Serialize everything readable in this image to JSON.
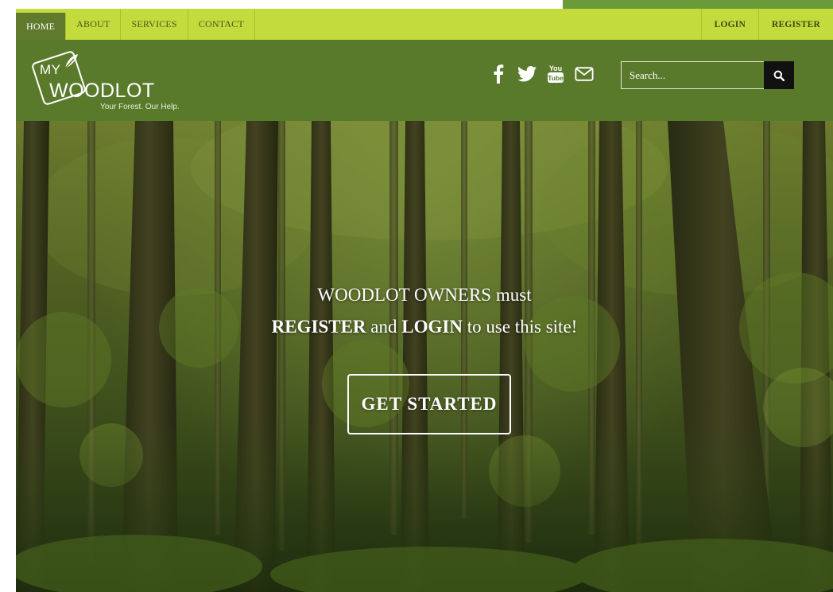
{
  "topnav": {
    "left_items": [
      {
        "label": "HOME",
        "active": true
      },
      {
        "label": "ABOUT"
      },
      {
        "label": "SERVICES"
      },
      {
        "label": "CONTACT"
      }
    ],
    "right_items": [
      {
        "label": "LOGIN"
      },
      {
        "label": "REGISTER"
      }
    ]
  },
  "logo": {
    "my": "MY",
    "name": "WOODLOT",
    "tagline": "Your Forest. Our Help."
  },
  "social": {
    "icons": [
      "facebook-icon",
      "twitter-icon",
      "youtube-icon",
      "email-icon"
    ]
  },
  "search": {
    "placeholder": "Search...",
    "icon": "search-icon"
  },
  "hero": {
    "line1": "WOODLOT OWNERS must",
    "line2_bold1": "REGISTER",
    "line2_mid": " and ",
    "line2_bold2": "LOGIN",
    "line2_end": " to use this site!",
    "cta_label": "GET STARTED"
  },
  "colors": {
    "topnav_bg": "#c3db3d",
    "header_bg": "#5a7a2b",
    "active_tab": "#5f7a2c",
    "search_button": "#111111"
  }
}
